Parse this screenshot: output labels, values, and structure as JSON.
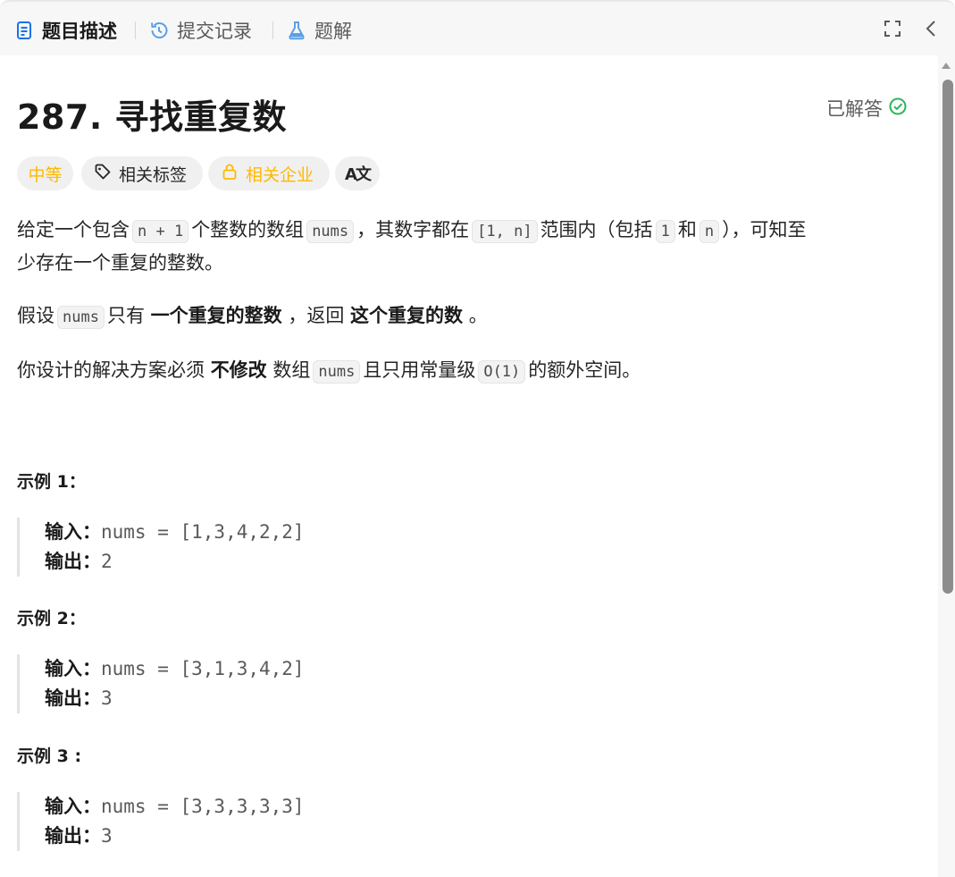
{
  "tabs": {
    "description": "题目描述",
    "submissions": "提交记录",
    "solutions": "题解"
  },
  "problem": {
    "title": "287. 寻找重复数",
    "status": "已解答"
  },
  "tags": {
    "difficulty": "中等",
    "topics": "相关标签",
    "companies": "相关企业",
    "translate_icon": "A文"
  },
  "description": {
    "p1": {
      "t1": "给定一个包含",
      "c1": "n + 1",
      "t2": "个整数的数组",
      "c2": "nums",
      "t3": "，其数字都在",
      "c3": "[1, n]",
      "t4": "范围内（包括",
      "c4": "1",
      "t5": "和",
      "c5": "n",
      "t6": "），可知至",
      "line2": "少存在一个重复的整数。"
    },
    "p2": {
      "t1": "假设",
      "c1": "nums",
      "t2": "只有",
      "b1": "一个重复的整数",
      "t3": "，返回",
      "b2": "这个重复的数",
      "t4": "。"
    },
    "p3": {
      "t1": "你设计的解决方案必须",
      "b1": "不修改",
      "t2": "数组",
      "c1": "nums",
      "t3": "且只用常量级",
      "c2": "O(1)",
      "t4": "的额外空间。"
    }
  },
  "examples": [
    {
      "title": "示例 1：",
      "input_label": "输入：",
      "input": "nums = [1,3,4,2,2]",
      "output_label": "输出：",
      "output": "2"
    },
    {
      "title": "示例 2：",
      "input_label": "输入：",
      "input": "nums = [3,1,3,4,2]",
      "output_label": "输出：",
      "output": "3"
    },
    {
      "title": "示例 3 :",
      "input_label": "输入：",
      "input": "nums = [3,3,3,3,3]",
      "output_label": "输出：",
      "output": "3"
    }
  ],
  "colors": {
    "accent_blue": "#1a73e8",
    "medium_yellow": "#ffb800",
    "solved_green": "#2db55d"
  }
}
